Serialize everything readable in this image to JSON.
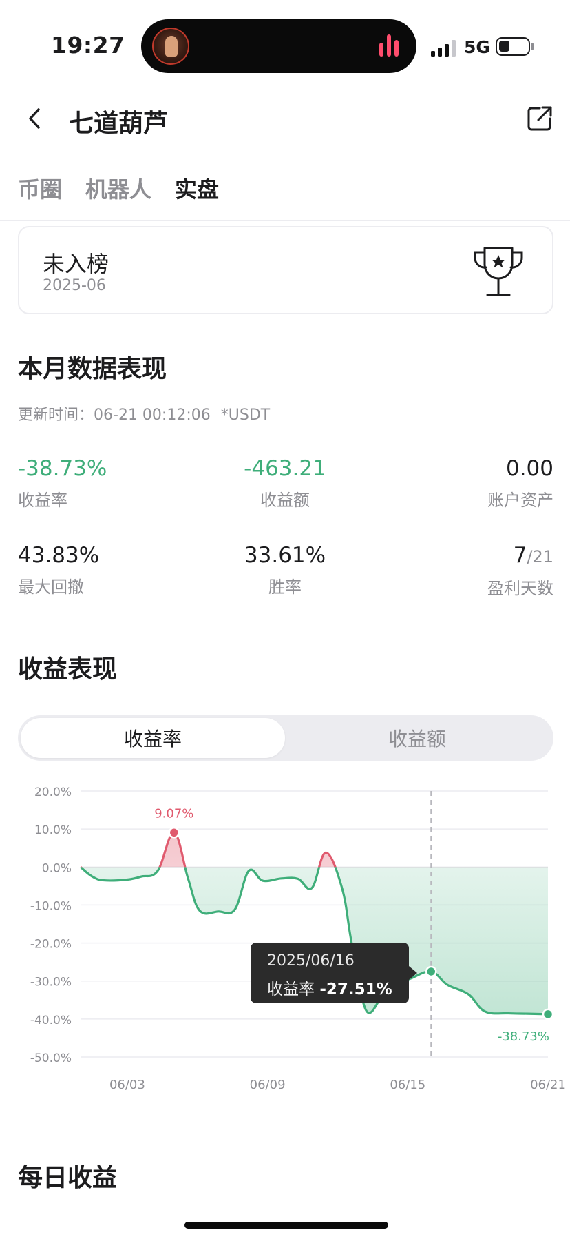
{
  "status": {
    "time": "19:27",
    "network": "5G"
  },
  "header": {
    "title": "七道葫芦"
  },
  "tabs": [
    {
      "label": "币圈",
      "active": false
    },
    {
      "label": "机器人",
      "active": false
    },
    {
      "label": "实盘",
      "active": true
    }
  ],
  "rank": {
    "status": "未入榜",
    "month": "2025-06"
  },
  "monthly": {
    "title": "本月数据表现",
    "update_label": "更新时间：",
    "update_time": "06-21 00:12:06",
    "currency": "*USDT",
    "metrics": [
      {
        "value": "-38.73%",
        "label": "收益率"
      },
      {
        "value": "-463.21",
        "label": "收益额"
      },
      {
        "value": "0.00",
        "label": "账户资产"
      },
      {
        "value": "43.83%",
        "label": "最大回撤"
      },
      {
        "value": "33.61%",
        "label": "胜率"
      },
      {
        "value": "7",
        "suffix": "/21",
        "label": "盈利天数"
      }
    ]
  },
  "performance": {
    "title": "收益表现",
    "segments": [
      {
        "label": "收益率",
        "active": true
      },
      {
        "label": "收益额",
        "active": false
      }
    ]
  },
  "chart_data": {
    "type": "area",
    "yunit": "%",
    "ylim": [
      -50,
      20
    ],
    "yticks": [
      "20.0%",
      "10.0%",
      "0.0%",
      "-10.0%",
      "-20.0%",
      "-30.0%",
      "-40.0%",
      "-50.0%"
    ],
    "ytick_values": [
      20,
      10,
      0,
      -10,
      -20,
      -30,
      -40,
      -50
    ],
    "xticks": [
      "06/03",
      "06/09",
      "06/15",
      "06/21"
    ],
    "xtick_values": [
      3,
      9,
      15,
      21
    ],
    "xlim": [
      1,
      21
    ],
    "series": [
      {
        "x": [
          1,
          1.5,
          2,
          3,
          3.6,
          4.3,
          5,
          5.6,
          6.1,
          6.9,
          7.6,
          8.2,
          8.8,
          9.6,
          10.3,
          10.9,
          11.5,
          12.2,
          12.6,
          13.2,
          13.8,
          14.1,
          15.1,
          16,
          16.7,
          17.6,
          18.3,
          19.3,
          20.1,
          21
        ],
        "y": [
          0,
          -2.5,
          -3.5,
          -3.3,
          -2.5,
          -1,
          9.07,
          -3,
          -11.5,
          -11.7,
          -11.2,
          -1,
          -3.6,
          -3,
          -3.1,
          -5.5,
          3.8,
          -5.8,
          -20,
          -37.5,
          -35,
          -32,
          -29.4,
          -27.51,
          -31,
          -33.5,
          -38,
          -38.5,
          -38.6,
          -38.73
        ]
      }
    ],
    "positive_color": "#e05a6e",
    "negative_color": "#3fae7a",
    "annotations": [
      {
        "x": 5,
        "y": 9.07,
        "text": "9.07%",
        "color": "#e05a6e"
      },
      {
        "x": 21,
        "y": -38.73,
        "text": "-38.73%",
        "color": "#3fae7a"
      }
    ],
    "crosshair": {
      "x": 16,
      "y": -27.51
    },
    "tooltip": {
      "date": "2025/06/16",
      "label": "收益率",
      "value": "-27.51%"
    }
  },
  "daily": {
    "title": "每日收益"
  }
}
